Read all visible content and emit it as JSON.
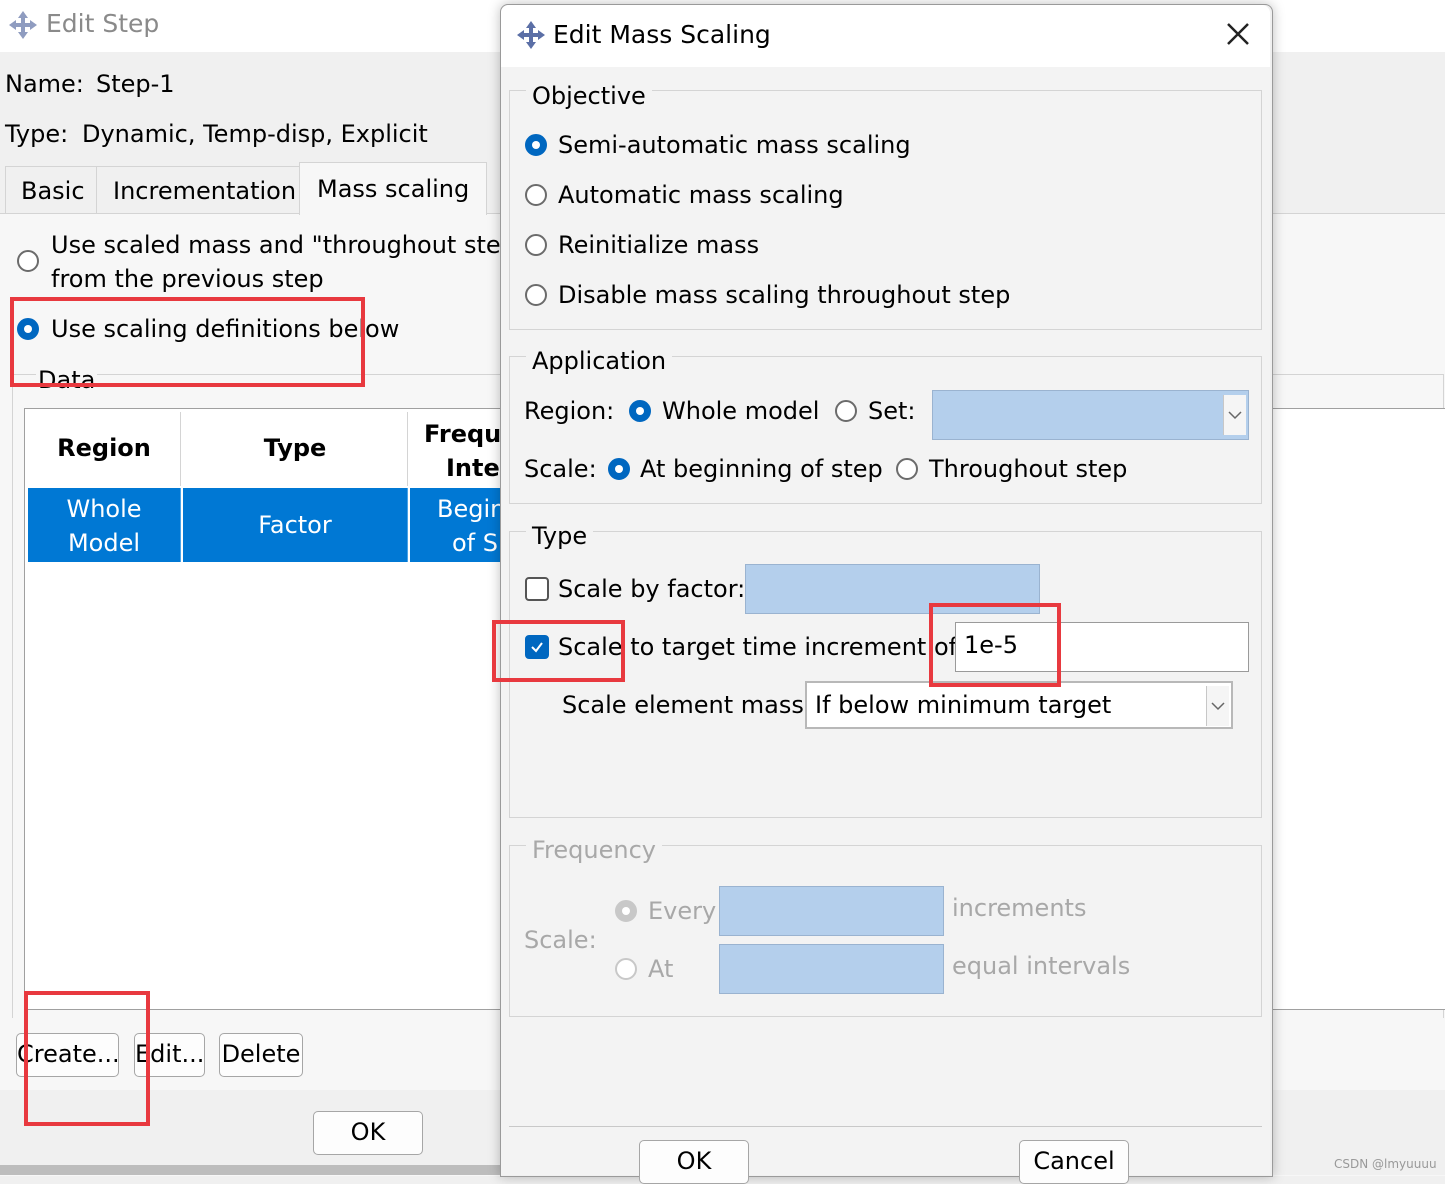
{
  "edit_step": {
    "title": "Edit Step",
    "name_label": "Name:",
    "name_value": "Step-1",
    "type_label": "Type:",
    "type_value": "Dynamic, Temp-disp, Explicit",
    "tabs": [
      {
        "label": "Basic"
      },
      {
        "label": "Incrementation"
      },
      {
        "label": "Mass scaling"
      }
    ],
    "options": {
      "prev_line1": "Use scaled mass and \"throughout step",
      "prev_line2": "from the previous step",
      "use_defs": "Use scaling definitions below"
    },
    "data_legend": "Data",
    "table": {
      "headers": [
        "Region",
        "Type",
        "Freque",
        "Inter"
      ],
      "row": {
        "region_l1": "Whole",
        "region_l2": "Model",
        "type": "Factor",
        "freq_l1": "Begin",
        "freq_l2": "of S"
      }
    },
    "buttons": {
      "create": "Create...",
      "edit": "Edit...",
      "delete": "Delete",
      "ok": "OK"
    }
  },
  "mass_scaling": {
    "title": "Edit Mass Scaling",
    "objective": {
      "legend": "Objective",
      "options": [
        {
          "label": "Semi-automatic mass scaling",
          "selected": true
        },
        {
          "label": "Automatic mass scaling",
          "selected": false
        },
        {
          "label": "Reinitialize mass",
          "selected": false
        },
        {
          "label": "Disable mass scaling throughout step",
          "selected": false
        }
      ]
    },
    "application": {
      "legend": "Application",
      "region_label": "Region:",
      "region_whole": "Whole model",
      "region_set": "Set:",
      "scale_label": "Scale:",
      "scale_beginning": "At beginning of step",
      "scale_throughout": "Throughout step"
    },
    "type": {
      "legend": "Type",
      "by_factor_label": "Scale by factor:",
      "by_factor_checked": false,
      "target_label": "Scale to target time increment of:",
      "target_checked": true,
      "target_value": "1e-5",
      "element_mass_label": "Scale element mass:",
      "element_mass_value": "If below minimum target"
    },
    "frequency": {
      "legend": "Frequency",
      "scale_label": "Scale:",
      "every_label": "Every",
      "increments_label": "increments",
      "at_label": "At",
      "intervals_label": "equal intervals"
    },
    "buttons": {
      "ok": "OK",
      "cancel": "Cancel"
    }
  },
  "watermark": "CSDN @lmyuuuu",
  "colors": {
    "accent": "#0067c0",
    "selection": "#0078d4",
    "field": "#b4cfec",
    "annotation": "#e8393f"
  }
}
